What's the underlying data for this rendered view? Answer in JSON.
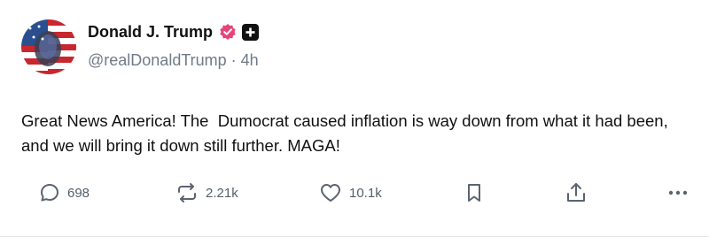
{
  "post": {
    "display_name": "Donald J. Trump",
    "handle": "@realDonaldTrump",
    "separator": "·",
    "time_ago": "4h",
    "text": "Great News America! The  Dumocrat caused inflation is way down from what it had been, and we will bring it down still further. MAGA!",
    "verified_icon": "verified-badge-icon",
    "plus_icon": "plus-badge-icon",
    "verified_color": "#e5457a"
  },
  "actions": {
    "reply_count": "698",
    "repost_count": "2.21k",
    "like_count": "10.1k",
    "bookmark_icon": "bookmark-icon",
    "share_icon": "share-icon",
    "more_icon": "more-icon"
  }
}
